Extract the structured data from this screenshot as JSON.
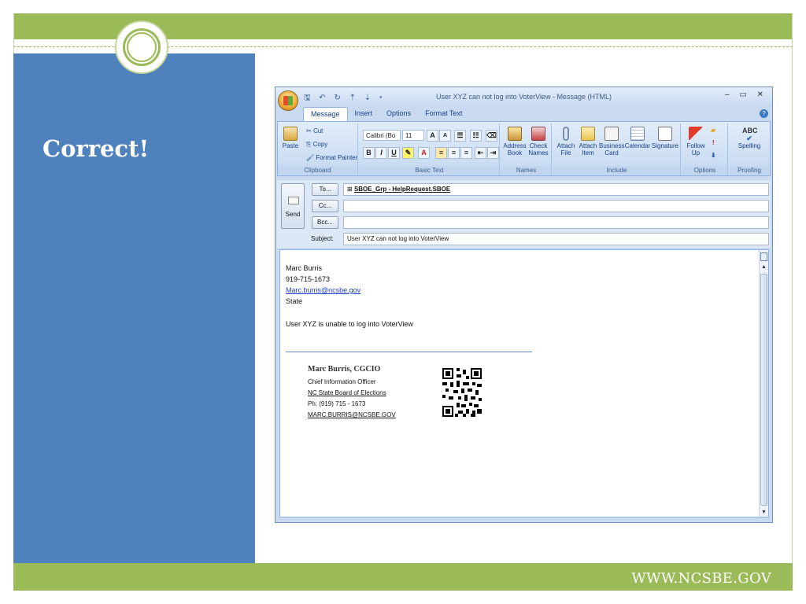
{
  "slide": {
    "title": "Correct!",
    "footer_url": "WWW.NCSBE.GOV"
  },
  "window": {
    "title": "User XYZ can not log into VoterView - Message (HTML)",
    "quick_access": "🖫 ↶ ↻ ⇡ ⇣ ▾",
    "controls": "– ▭ ✕",
    "tabs": [
      "Message",
      "Insert",
      "Options",
      "Format Text"
    ],
    "help": "?"
  },
  "ribbon": {
    "clipboard": {
      "paste": "Paste",
      "cut": "Cut",
      "copy": "Copy",
      "format_painter": "Format Painter",
      "label": "Clipboard"
    },
    "basic_text": {
      "font": "Calibri (Bo",
      "size": "11",
      "bold": "B",
      "italic": "I",
      "underline": "U",
      "label": "Basic Text"
    },
    "names": {
      "address_book": "Address Book",
      "check_names": "Check Names",
      "label": "Names"
    },
    "include": {
      "attach_file": "Attach File",
      "attach_item": "Attach Item",
      "business_card": "Business Card",
      "calendar": "Calendar",
      "signature": "Signature",
      "label": "Include"
    },
    "options": {
      "follow_up": "Follow Up",
      "label": "Options"
    },
    "proofing": {
      "spelling": "Spelling",
      "label": "Proofing"
    }
  },
  "header": {
    "send": "Send",
    "to_btn": "To...",
    "cc_btn": "Cc...",
    "bcc_btn": "Bcc...",
    "to_value": "SBOE_Grp - HelpRequest.SBOE",
    "cc_value": "",
    "bcc_value": "",
    "subject_label": "Subject:",
    "subject_value": "User XYZ can not log into VoterView"
  },
  "body": {
    "name": "Marc Burris",
    "phone": "919-715-1673",
    "email": "Marc.burris@ncsbe.gov",
    "org": "State",
    "message": "User XYZ is unable to log into VoterView",
    "signature": {
      "name": "Marc Burris, CGCIO",
      "role": "Chief Information Officer",
      "agency": "NC State Board of Elections",
      "phone": "Ph: (919) 715 - 1673",
      "email": "MARC.BURRIS@NCSBE.GOV"
    }
  },
  "colors": {
    "accent_green": "#9bbb59",
    "panel_blue": "#4f81bd"
  }
}
